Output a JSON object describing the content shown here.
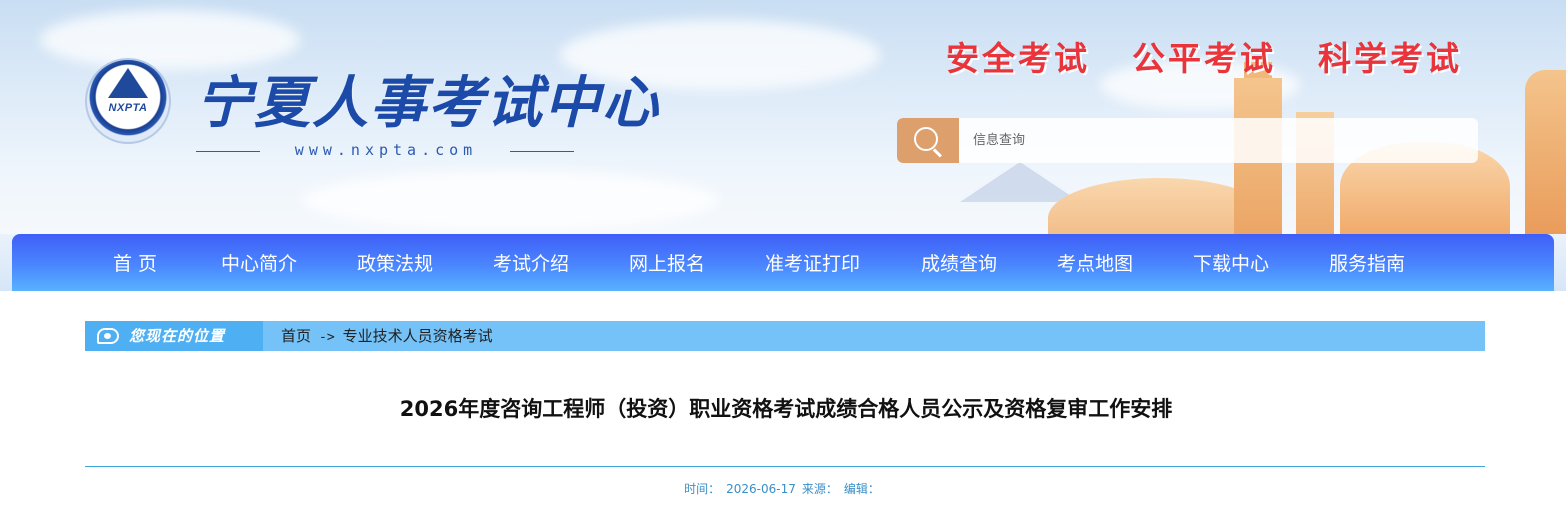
{
  "header": {
    "site_title": "宁夏人事考试中心",
    "site_url": "www.nxpta.com",
    "logo_text": "NXPTA",
    "slogans": [
      "安全考试",
      "公平考试",
      "科学考试"
    ],
    "search": {
      "placeholder": "信息查询"
    }
  },
  "nav": {
    "items": [
      "首 页",
      "中心简介",
      "政策法规",
      "考试介绍",
      "网上报名",
      "准考证打印",
      "成绩查询",
      "考点地图",
      "下载中心",
      "服务指南"
    ]
  },
  "breadcrumb": {
    "label": "您现在的位置",
    "home": "首页",
    "separator": "->",
    "current": "专业技术人员资格考试"
  },
  "article": {
    "title": "2026年度咨询工程师（投资）职业资格考试成绩合格人员公示及资格复审工作安排",
    "meta": {
      "time_label": "时间：",
      "time_value": "2026-06-17",
      "source_label": "来源：",
      "editor_label": "编辑："
    }
  },
  "colors": {
    "nav_gradient_top": "#3f5ff7",
    "nav_gradient_bottom": "#58b2ff",
    "slogan": "#e8343a",
    "search_button": "#dda06c",
    "breadcrumb_bar": "#74c2f7",
    "meta_text": "#3a8fc6"
  },
  "icons": {
    "logo": "nxpta-logo-icon",
    "search": "search-icon",
    "breadcrumb": "location-bubble-icon"
  }
}
